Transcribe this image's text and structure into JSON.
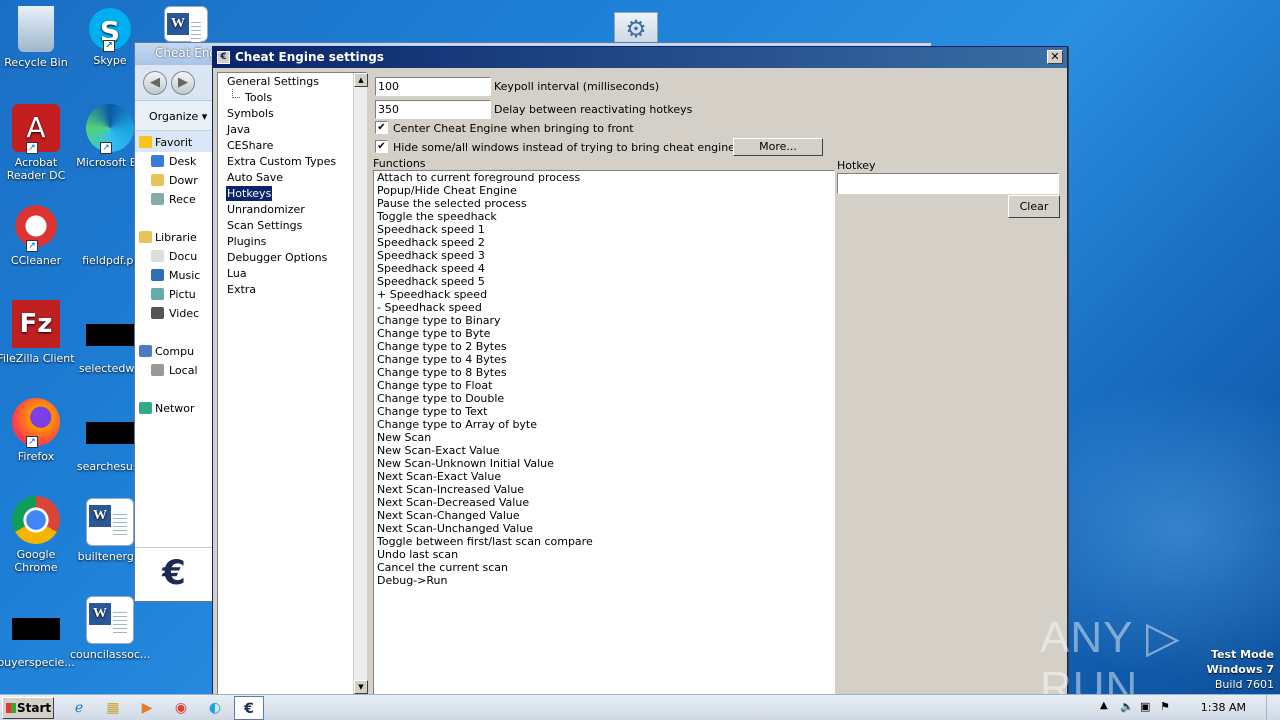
{
  "desktop": {
    "icons": [
      {
        "label": "Recycle Bin"
      },
      {
        "label": "Skype"
      },
      {
        "label": "Acrobat Reader DC"
      },
      {
        "label": "Microsoft Ed"
      },
      {
        "label": "CCleaner"
      },
      {
        "label": "fieldpdf.pr"
      },
      {
        "label": "FileZilla Client"
      },
      {
        "label": "selectedwo"
      },
      {
        "label": "Firefox"
      },
      {
        "label": "searchesusr"
      },
      {
        "label": "Google Chrome"
      },
      {
        "label": "builtenergy."
      },
      {
        "label": "buyerspecie..."
      },
      {
        "label": "councilassoc..."
      }
    ]
  },
  "explorer": {
    "title": "Cheat Engi",
    "organize": "Organize",
    "tree": [
      "Favorit",
      "Desk",
      "Dowr",
      "Rece",
      "Librarie",
      "Docu",
      "Music",
      "Pictu",
      "Videc",
      "Compu",
      "Local",
      "Networ"
    ]
  },
  "dialog": {
    "title": "Cheat Engine settings",
    "close": "✕",
    "categories": [
      {
        "label": "General Settings"
      },
      {
        "label": "Tools"
      },
      {
        "label": "Symbols"
      },
      {
        "label": "Java"
      },
      {
        "label": "CEShare"
      },
      {
        "label": "Extra Custom Types"
      },
      {
        "label": "Auto Save"
      },
      {
        "label": "Hotkeys"
      },
      {
        "label": "Unrandomizer"
      },
      {
        "label": "Scan Settings"
      },
      {
        "label": "Plugins"
      },
      {
        "label": "Debugger Options"
      },
      {
        "label": "Lua"
      },
      {
        "label": "Extra"
      }
    ],
    "keypoll_value": "100",
    "keypoll_label": "Keypoll interval (milliseconds)",
    "delay_value": "350",
    "delay_label": "Delay between reactivating hotkeys",
    "center_label": "Center Cheat Engine when bringing to front",
    "center_checked": "✔",
    "hide_label": "Hide some/all windows instead of trying to bring cheat engine to front",
    "hide_checked": "✔",
    "more_button": "More...",
    "functions_label": "Functions",
    "hotkey_label": "Hotkey",
    "hotkey_value": "",
    "clear_button": "Clear",
    "functions": [
      "Attach to current foreground process",
      "Popup/Hide Cheat Engine",
      "Pause the selected process",
      "Toggle the speedhack",
      "Speedhack speed 1",
      "Speedhack speed 2",
      "Speedhack speed 3",
      "Speedhack speed 4",
      "Speedhack speed 5",
      "+ Speedhack speed",
      "- Speedhack speed",
      "Change type to Binary",
      "Change type to Byte",
      "Change type to 2 Bytes",
      "Change type to 4 Bytes",
      "Change type to 8 Bytes",
      "Change type to Float",
      "Change type to Double",
      "Change type to Text",
      "Change type to Array of byte",
      "New Scan",
      "New Scan-Exact Value",
      "New Scan-Unknown Initial Value",
      "Next Scan-Exact Value",
      "Next Scan-Increased Value",
      "Next Scan-Decreased Value",
      "Next Scan-Changed Value",
      "Next Scan-Unchanged Value",
      "Toggle between first/last scan compare",
      "Undo last scan",
      "Cancel the current scan",
      "Debug->Run"
    ]
  },
  "taskbar": {
    "start": "Start",
    "clock": "1:38 AM"
  },
  "watermark": {
    "brand": "ANY ▷ RUN",
    "line1": "Test Mode",
    "line2": "Windows 7",
    "line3": "Build 7601"
  }
}
